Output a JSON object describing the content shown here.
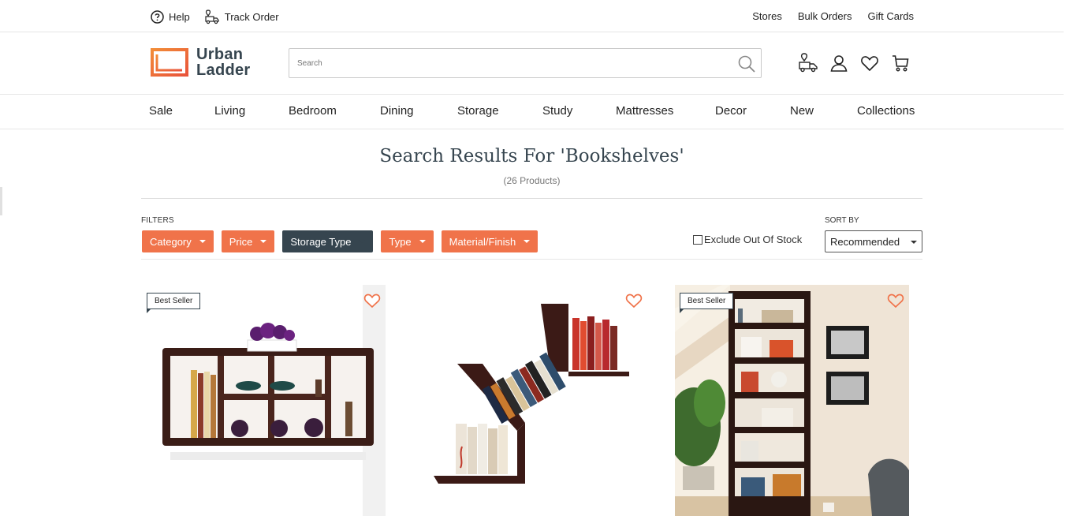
{
  "topbar": {
    "help": "Help",
    "track_order": "Track Order",
    "stores": "Stores",
    "bulk_orders": "Bulk Orders",
    "gift_cards": "Gift Cards"
  },
  "brand": {
    "line1": "Urban",
    "line2": "Ladder",
    "accent": "#f0734a",
    "dark": "#36454f"
  },
  "search": {
    "placeholder": "Search",
    "value": ""
  },
  "nav": [
    "Sale",
    "Living",
    "Bedroom",
    "Dining",
    "Storage",
    "Study",
    "Mattresses",
    "Decor",
    "New",
    "Collections"
  ],
  "results": {
    "title": "Search Results For 'Bookshelves'",
    "count": "(26 Products)"
  },
  "filters": {
    "label": "FILTERS",
    "chips": [
      "Category",
      "Price",
      "Storage Type",
      "Type",
      "Material/Finish"
    ],
    "active_chip": "Storage Type",
    "exclude_label": "Exclude Out Of Stock",
    "exclude_checked": false
  },
  "sort": {
    "label": "SORT BY",
    "value": "Recommended"
  },
  "products": [
    {
      "badge": "Best Seller"
    },
    {
      "badge": ""
    },
    {
      "badge": "Best Seller"
    }
  ]
}
